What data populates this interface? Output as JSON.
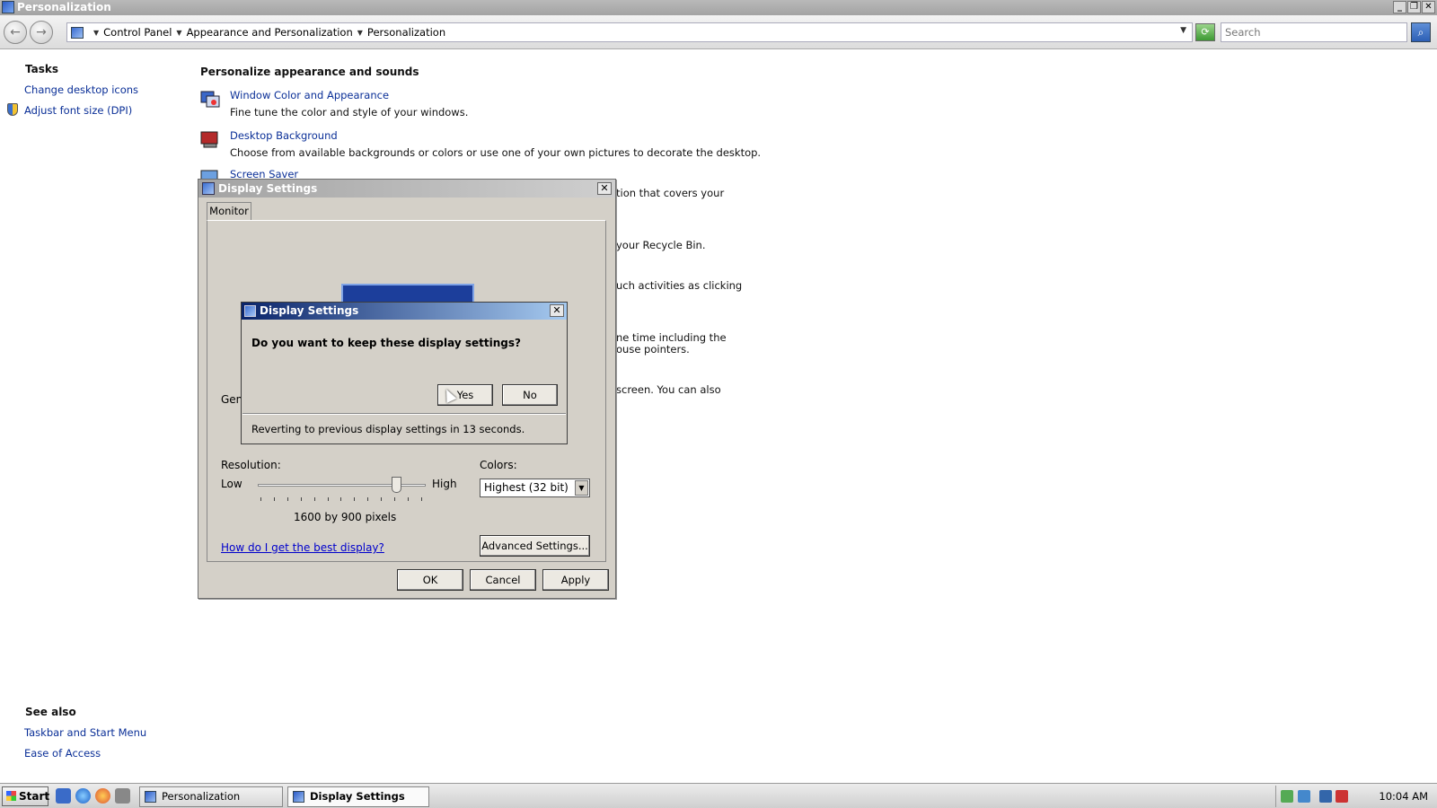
{
  "window": {
    "title": "Personalization",
    "controls": [
      "_",
      "❐",
      "✕"
    ]
  },
  "address": {
    "breadcrumbs": [
      "Control Panel",
      "Appearance and Personalization",
      "Personalization"
    ],
    "search_placeholder": "Search"
  },
  "sidebar": {
    "tasks_heading": "Tasks",
    "tasks": [
      "Change desktop icons",
      "Adjust font size (DPI)"
    ],
    "see_also_heading": "See also",
    "see_also": [
      "Taskbar and Start Menu",
      "Ease of Access"
    ]
  },
  "main": {
    "heading": "Personalize appearance and sounds",
    "items": [
      {
        "title": "Window Color and Appearance",
        "desc": "Fine tune the color and style of your windows."
      },
      {
        "title": "Desktop Background",
        "desc": "Choose from available backgrounds or colors or use one of your own pictures to decorate the desktop."
      },
      {
        "title": "Screen Saver"
      }
    ],
    "partial_texts": [
      "tion that covers your",
      "your Recycle Bin.",
      "uch activities as clicking",
      "ne time including the",
      "ouse pointers.",
      "screen. You can also"
    ]
  },
  "display_settings": {
    "title": "Display Settings",
    "tab": "Monitor",
    "gen_label": "Gen",
    "resolution_label": "Resolution:",
    "low": "Low",
    "high": "High",
    "resolution_value": "1600 by 900 pixels",
    "colors_label": "Colors:",
    "colors_value": "Highest (32 bit)",
    "help_link": "How do I get the best display?",
    "advanced_button": "Advanced Settings...",
    "ok": "OK",
    "cancel": "Cancel",
    "apply": "Apply"
  },
  "confirm_dialog": {
    "title": "Display Settings",
    "question": "Do you want to keep these display settings?",
    "yes": "Yes",
    "no": "No",
    "revert_text": "Reverting to previous display settings in 13 seconds."
  },
  "taskbar": {
    "start": "Start",
    "tasks": [
      "Personalization",
      "Display Settings"
    ],
    "clock": "10:04 AM"
  }
}
